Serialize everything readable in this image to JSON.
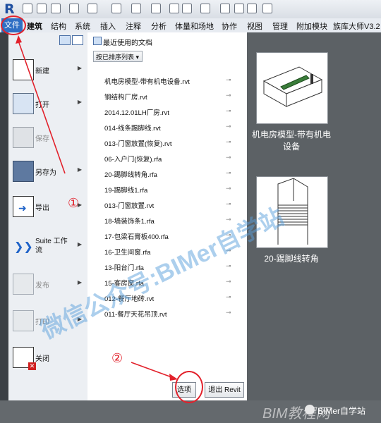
{
  "app": {
    "logo": "R"
  },
  "ribbon": {
    "file_tab": "文件",
    "tabs": [
      "建筑",
      "结构",
      "系统",
      "插入",
      "注释",
      "分析",
      "体量和场地",
      "协作",
      "视图",
      "管理",
      "附加模块",
      "族库大师V3.2"
    ]
  },
  "menu": {
    "items": [
      {
        "label": "新建",
        "icon": "new-icon",
        "arrow": true
      },
      {
        "label": "打开",
        "icon": "open-folder-icon",
        "arrow": true
      },
      {
        "label": "保存",
        "icon": "save-icon",
        "arrow": false
      },
      {
        "label": "另存为",
        "icon": "save-as-icon",
        "arrow": true
      },
      {
        "label": "导出",
        "icon": "export-icon",
        "arrow": true
      },
      {
        "label": "Suite 工作流",
        "icon": "suite-workflow-icon",
        "arrow": true
      },
      {
        "label": "发布",
        "icon": "publish-icon",
        "arrow": true
      },
      {
        "label": "打印",
        "icon": "print-icon",
        "arrow": true
      },
      {
        "label": "关闭",
        "icon": "close-doc-icon",
        "arrow": false
      }
    ]
  },
  "recent": {
    "title": "最近使用的文档",
    "sort_label": "按已排序列表",
    "files": [
      "机电房模型-带有机电设备.rvt",
      "钢结构厂房.rvt",
      "2014.12.01LH厂房.rvt",
      "014-线条踢脚线.rvt",
      "013-门窗放置(恢复).rvt",
      "06-入户门(恢复).rfa",
      "20-踢脚线转角.rfa",
      "19-踢脚线1.rfa",
      "013-门窗放置.rvt",
      "18-墙装饰条1.rfa",
      "17-包梁石膏板400.rfa",
      "16-卫生间窗.rfa",
      "13-阳台门.rfa",
      "15-客房窗.rfa",
      "012-餐厅地砖.rvt",
      "011-餐厅天花吊顶.rvt"
    ]
  },
  "buttons": {
    "options": "选项",
    "exit": "退出 Revit"
  },
  "thumbnails": [
    {
      "caption_line1": "机电房模型-带有机电",
      "caption_line2": "设备"
    },
    {
      "caption_line1": "20-踢脚线转角",
      "caption_line2": ""
    }
  ],
  "annotations": {
    "num1": "①",
    "num2": "②"
  },
  "watermark": {
    "text": "微信公众号:BIMer自学站",
    "footer_brand": "BIMer自学站",
    "footer_site": "BIM教程网"
  }
}
